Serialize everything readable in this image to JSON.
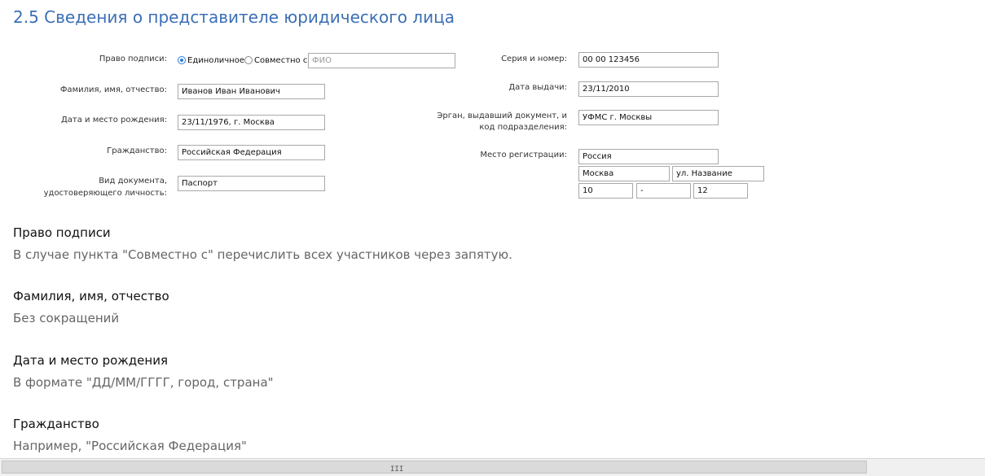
{
  "title": "2.5 Сведения о представителе юридического лица",
  "form": {
    "signing_right_label": "Право подписи:",
    "radio_single": "Единоличное",
    "radio_joint": "Совместно с",
    "joint_placeholder": "ФИО",
    "fullname_label": "Фамилия, имя, отчество:",
    "fullname_value": "Иванов Иван Иванович",
    "birth_label": "Дата и место рождения:",
    "birth_value": "23/11/1976, г. Москва",
    "citizenship_label": "Гражданство:",
    "citizenship_value": "Российская Федерация",
    "doc_label_1": "Вид документа,",
    "doc_label_2": "удостоверяющего личность:",
    "doc_value": "Паспорт",
    "series_label": "Серия и номер:",
    "series_value": "00 00 123456",
    "issue_date_label": "Дата выдачи:",
    "issue_date_value": "23/11/2010",
    "issuer_label_1": "Эрган, выдавший документ, и",
    "issuer_label_2": "код подразделения:",
    "issuer_value": "УФМС г. Москвы",
    "reg_label": "Место регистрации:",
    "reg_country": "Россия",
    "reg_city": "Москва",
    "reg_street": "ул. Название",
    "reg_house": "10",
    "reg_building": "-",
    "reg_apt": "12"
  },
  "help": [
    {
      "heading": "Право подписи",
      "text": "В случае пункта \"Совместно с\" перечислить всех участников через запятую."
    },
    {
      "heading": "Фамилия, имя, отчество",
      "text": "Без сокращений"
    },
    {
      "heading": "Дата и место рождения",
      "text": "В формате \"ДД/ММ/ГГГГ, город, страна\""
    },
    {
      "heading": "Гражданство",
      "text": "Например, \"Российская Федерация\""
    }
  ],
  "scrollbar": {
    "grip": "III"
  }
}
